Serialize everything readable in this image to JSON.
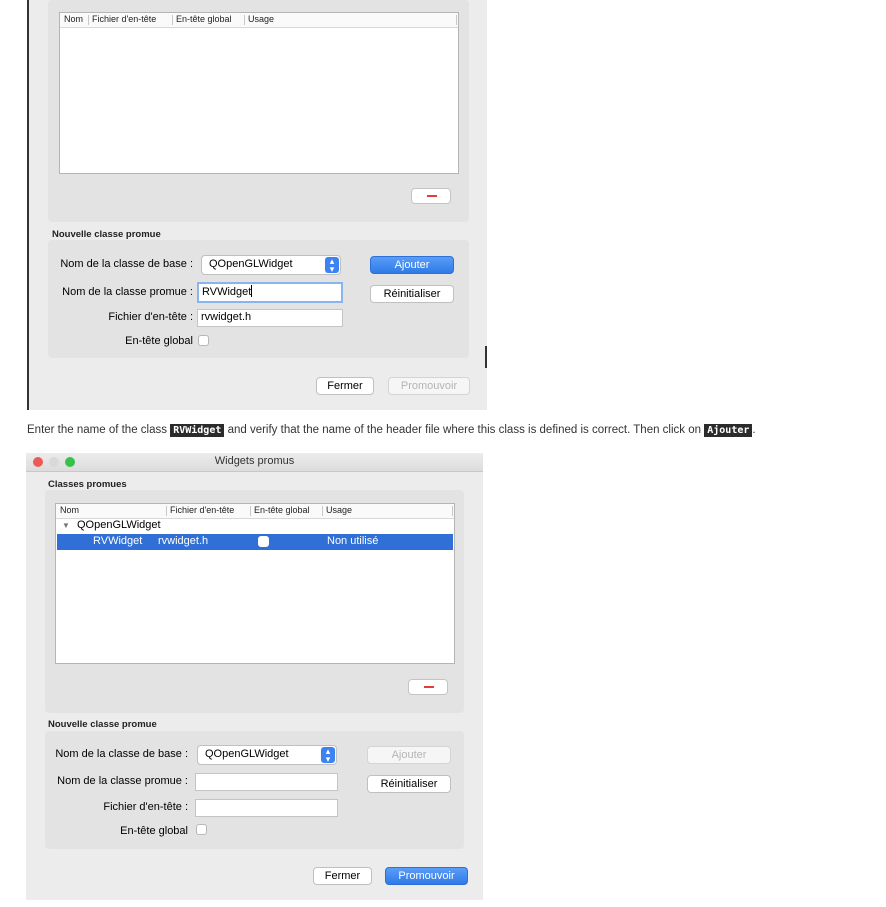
{
  "dialog1": {
    "table_headers": [
      "Nom",
      "Fichier d'en-tête",
      "En-tête global",
      "Usage"
    ],
    "section_new": "Nouvelle classe promue",
    "base_class_label": "Nom de la classe de base :",
    "base_class_value": "QOpenGLWidget",
    "promoted_class_label": "Nom de la classe promue :",
    "promoted_class_value": "RVWidget",
    "header_file_label": "Fichier d'en-tête :",
    "header_file_value": "rvwidget.h",
    "global_header_label": "En-tête global",
    "add_button": "Ajouter",
    "reset_button": "Réinitialiser",
    "close_button": "Fermer",
    "promote_button": "Promouvoir"
  },
  "caption": {
    "part1": "Enter the name of the class",
    "code1": "RVWidget",
    "part2": "and verify that the name of the header file where this class is defined is correct. Then click on",
    "code2": "Ajouter",
    "part3": "."
  },
  "dialog2": {
    "title": "Widgets promus",
    "section_promoted": "Classes promues",
    "table_headers": [
      "Nom",
      "Fichier d'en-tête",
      "En-tête global",
      "Usage"
    ],
    "tree_parent": "QOpenGLWidget",
    "tree_child": {
      "name": "RVWidget",
      "header": "rvwidget.h",
      "global_header": false,
      "usage": "Non utilisé"
    },
    "section_new": "Nouvelle classe promue",
    "base_class_label": "Nom de la classe de base :",
    "base_class_value": "QOpenGLWidget",
    "promoted_class_label": "Nom de la classe promue :",
    "promoted_class_value": "",
    "header_file_label": "Fichier d'en-tête :",
    "header_file_value": "",
    "global_header_label": "En-tête global",
    "add_button": "Ajouter",
    "reset_button": "Réinitialiser",
    "close_button": "Fermer",
    "promote_button": "Promouvoir"
  },
  "colors": {
    "accent": "#2f7ae8",
    "selection": "#2f6fd6",
    "traffic_close": "#ec5a55",
    "traffic_minimize": "#d9d9d9",
    "traffic_maximize": "#36c24a"
  }
}
